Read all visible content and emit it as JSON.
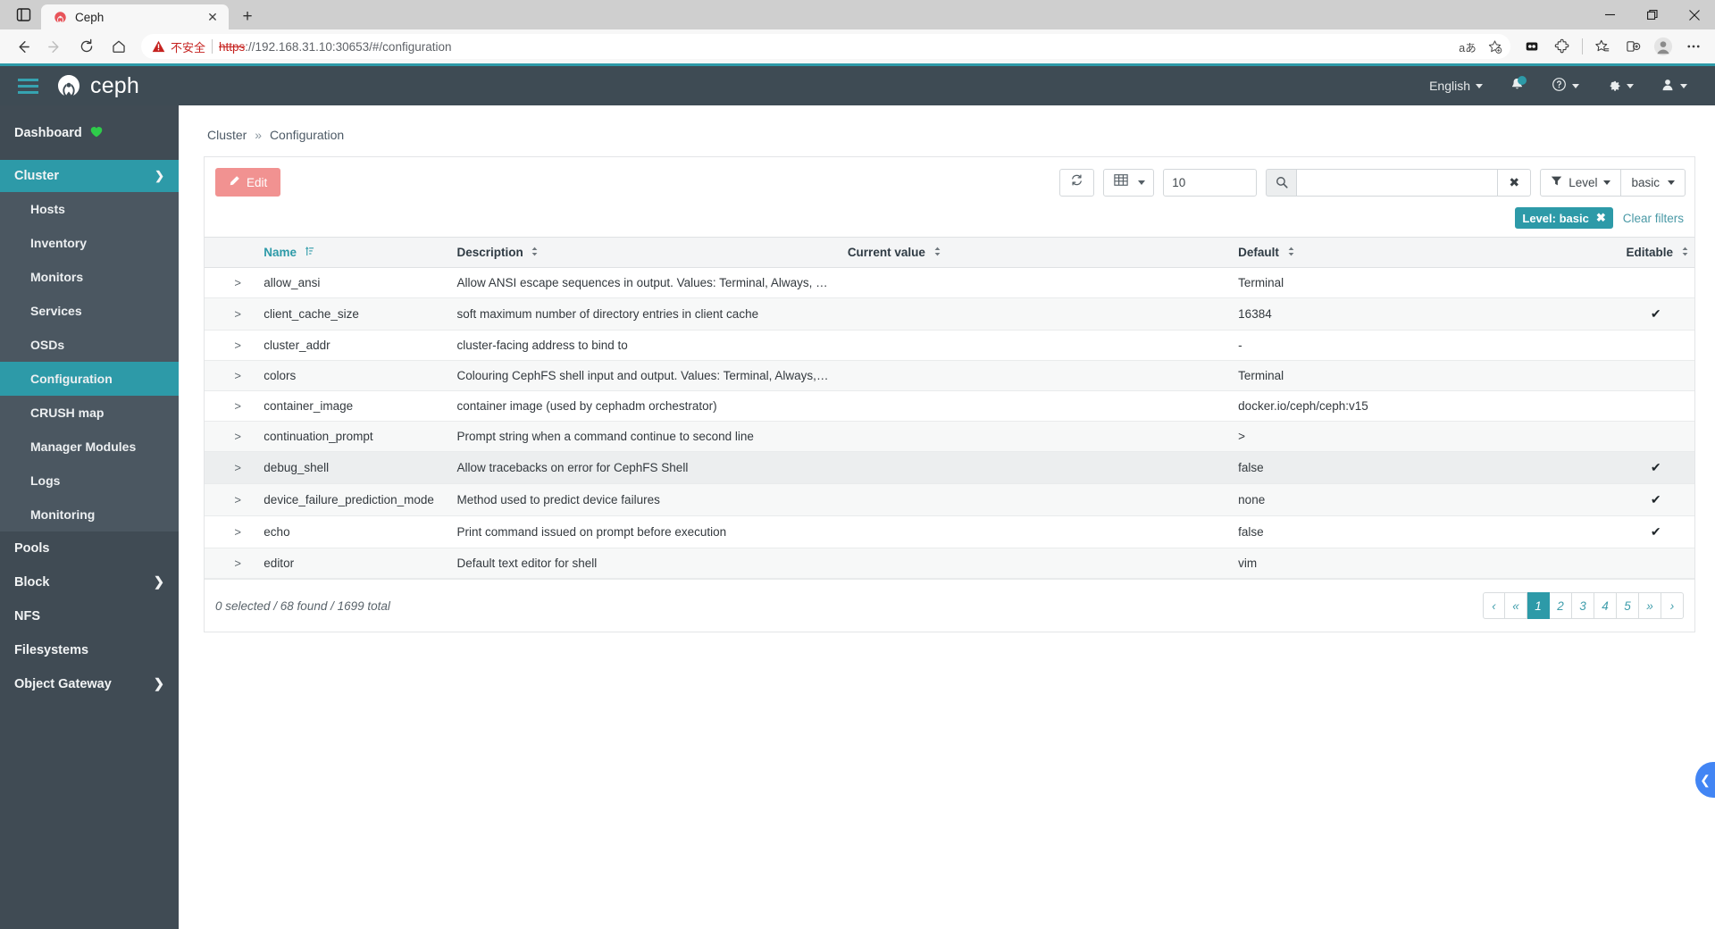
{
  "browser": {
    "tab": {
      "title": "Ceph",
      "favicon_icon": "ceph-favicon",
      "close_icon": "close-icon"
    },
    "new_tab_label": "+",
    "tab_sidebar_icon": "tab-sidebar-icon",
    "window": {
      "minimize": "minimize-icon",
      "maximize": "maximize-icon",
      "close": "close-icon"
    },
    "nav": {
      "back": "back-arrow-icon",
      "forward": "forward-arrow-icon",
      "reload": "reload-icon",
      "home": "home-icon"
    },
    "omnibox": {
      "security_label": "不安全",
      "security_icon": "warning-triangle-icon",
      "url_scheme": "https",
      "url_rest": "://192.168.31.10:30653/#/configuration",
      "url_host": "192.168.31.10",
      "url_port": ":30653",
      "url_path": "/#/configuration",
      "translate_icon": "translate-icon",
      "favorite_icon": "add-favorite-star-icon"
    },
    "toolbar_icons": [
      "collections-icon",
      "extensions-icon",
      "favorites-icon",
      "split-screen-icon",
      "profile-icon",
      "settings-more-icon"
    ]
  },
  "navbar": {
    "brand": "ceph",
    "hamburger_icon": "hamburger-menu-icon",
    "language": "English",
    "notifications_icon": "bell-icon",
    "help_icon": "help-icon",
    "settings_icon": "gear-icon",
    "user_icon": "user-icon"
  },
  "sidebar": {
    "dashboard": {
      "label": "Dashboard",
      "health_icon": "heart-icon"
    },
    "cluster": {
      "label": "Cluster",
      "chevron_icon": "chevron-down-icon"
    },
    "cluster_items": [
      {
        "label": "Hosts",
        "active": false
      },
      {
        "label": "Inventory",
        "active": false
      },
      {
        "label": "Monitors",
        "active": false
      },
      {
        "label": "Services",
        "active": false
      },
      {
        "label": "OSDs",
        "active": false
      },
      {
        "label": "Configuration",
        "active": true
      },
      {
        "label": "CRUSH map",
        "active": false
      },
      {
        "label": "Manager Modules",
        "active": false
      },
      {
        "label": "Logs",
        "active": false
      },
      {
        "label": "Monitoring",
        "active": false
      }
    ],
    "other_items": [
      {
        "label": "Pools",
        "chevron": false
      },
      {
        "label": "Block",
        "chevron": true
      },
      {
        "label": "NFS",
        "chevron": false
      },
      {
        "label": "Filesystems",
        "chevron": false
      },
      {
        "label": "Object Gateway",
        "chevron": true
      }
    ]
  },
  "breadcrumb": {
    "root": "Cluster",
    "separator": "»",
    "current": "Configuration"
  },
  "toolbar": {
    "edit_label": "Edit",
    "edit_icon": "pencil-icon",
    "refresh_icon": "refresh-icon",
    "columns_icon": "table-columns-icon",
    "limit_value": "10",
    "search_icon": "search-icon",
    "search_value": "",
    "search_clear_icon": "clear-icon",
    "filter_icon": "funnel-icon",
    "level_label": "Level",
    "level_value": "basic"
  },
  "filters": {
    "chip_label": "Level: basic",
    "chip_remove_icon": "remove-chip-icon",
    "clear_label": "Clear filters"
  },
  "table": {
    "columns": [
      {
        "label": "Name",
        "sorted": true,
        "sort_icon": "sort-asc-icon"
      },
      {
        "label": "Description",
        "sorted": false,
        "sort_icon": "sort-icon"
      },
      {
        "label": "Current value",
        "sorted": false,
        "sort_icon": "sort-icon"
      },
      {
        "label": "Default",
        "sorted": false,
        "sort_icon": "sort-icon"
      },
      {
        "label": "Editable",
        "sorted": false,
        "sort_icon": "sort-icon"
      }
    ],
    "expand_icon": ">",
    "check_icon": "✔",
    "rows": [
      {
        "name": "allow_ansi",
        "description": "Allow ANSI escape sequences in output. Values: Terminal, Always, Never",
        "current": "",
        "default": "Terminal",
        "editable": false
      },
      {
        "name": "client_cache_size",
        "description": "soft maximum number of directory entries in client cache",
        "current": "",
        "default": "16384",
        "editable": true
      },
      {
        "name": "cluster_addr",
        "description": "cluster-facing address to bind to",
        "current": "",
        "default": "-",
        "editable": false
      },
      {
        "name": "colors",
        "description": "Colouring CephFS shell input and output. Values: Terminal, Always, Never",
        "current": "",
        "default": "Terminal",
        "editable": false
      },
      {
        "name": "container_image",
        "description": "container image (used by cephadm orchestrator)",
        "current": "",
        "default": "docker.io/ceph/ceph:v15",
        "editable": false
      },
      {
        "name": "continuation_prompt",
        "description": "Prompt string when a command continue to second line",
        "current": "",
        "default": ">",
        "editable": false
      },
      {
        "name": "debug_shell",
        "description": "Allow tracebacks on error for CephFS Shell",
        "current": "",
        "default": "false",
        "editable": true
      },
      {
        "name": "device_failure_prediction_mode",
        "description": "Method used to predict device failures",
        "current": "",
        "default": "none",
        "editable": true
      },
      {
        "name": "echo",
        "description": "Print command issued on prompt before execution",
        "current": "",
        "default": "false",
        "editable": true
      },
      {
        "name": "editor",
        "description": "Default text editor for shell",
        "current": "",
        "default": "vim",
        "editable": false
      }
    ]
  },
  "footer": {
    "status": "0 selected / 68 found / 1699 total",
    "pages": [
      {
        "label": "‹",
        "active": false
      },
      {
        "label": "«",
        "active": false
      },
      {
        "label": "1",
        "active": true
      },
      {
        "label": "2",
        "active": false
      },
      {
        "label": "3",
        "active": false
      },
      {
        "label": "4",
        "active": false
      },
      {
        "label": "5",
        "active": false
      },
      {
        "label": "»",
        "active": false
      },
      {
        "label": "›",
        "active": false
      }
    ]
  },
  "side_toggle": {
    "icon": "chevron-left-icon"
  },
  "colors": {
    "accent_teal": "#2d9aa8",
    "sidebar_dark": "#404b54",
    "navbar_dark": "#3e4b54",
    "edit_salmon": "#f19291",
    "toggle_blue": "#4285f4"
  }
}
